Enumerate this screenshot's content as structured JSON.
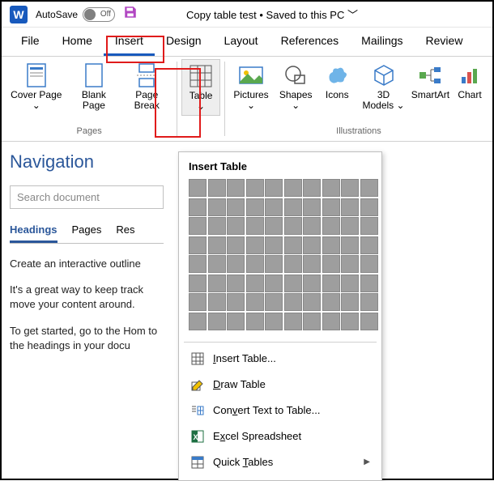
{
  "titlebar": {
    "autosave_label": "AutoSave",
    "autosave_state": "Off",
    "doc_title": "Copy table test • Saved to this PC  ﹀"
  },
  "tabs": [
    "File",
    "Home",
    "Insert",
    "Design",
    "Layout",
    "References",
    "Mailings",
    "Review"
  ],
  "active_tab_index": 2,
  "ribbon": {
    "pages": {
      "label": "Pages",
      "items": [
        "Cover Page ⌄",
        "Blank Page",
        "Page Break"
      ]
    },
    "table": {
      "label": "Table ⌄"
    },
    "illus": {
      "label": "Illustrations",
      "items": [
        "Pictures ⌄",
        "Shapes ⌄",
        "Icons",
        "3D Models ⌄",
        "SmartArt",
        "Chart"
      ]
    }
  },
  "nav": {
    "title": "Navigation",
    "search_placeholder": "Search document",
    "tabs": [
      "Headings",
      "Pages",
      "Res"
    ],
    "active": 0,
    "paras": [
      "Create an interactive outline",
      "It's a great way to keep track move your content around.",
      "To get started, go to the Hom to the headings in your docu"
    ]
  },
  "dropdown": {
    "title": "Insert Table",
    "items": [
      {
        "label_pre": "",
        "u": "I",
        "label_post": "nsert Table..."
      },
      {
        "label_pre": "",
        "u": "D",
        "label_post": "raw Table"
      },
      {
        "label_pre": "Con",
        "u": "v",
        "label_post": "ert Text to Table..."
      },
      {
        "label_pre": "E",
        "u": "x",
        "label_post": "cel Spreadsheet"
      },
      {
        "label_pre": "Quick ",
        "u": "T",
        "label_post": "ables",
        "arrow": true
      }
    ]
  }
}
